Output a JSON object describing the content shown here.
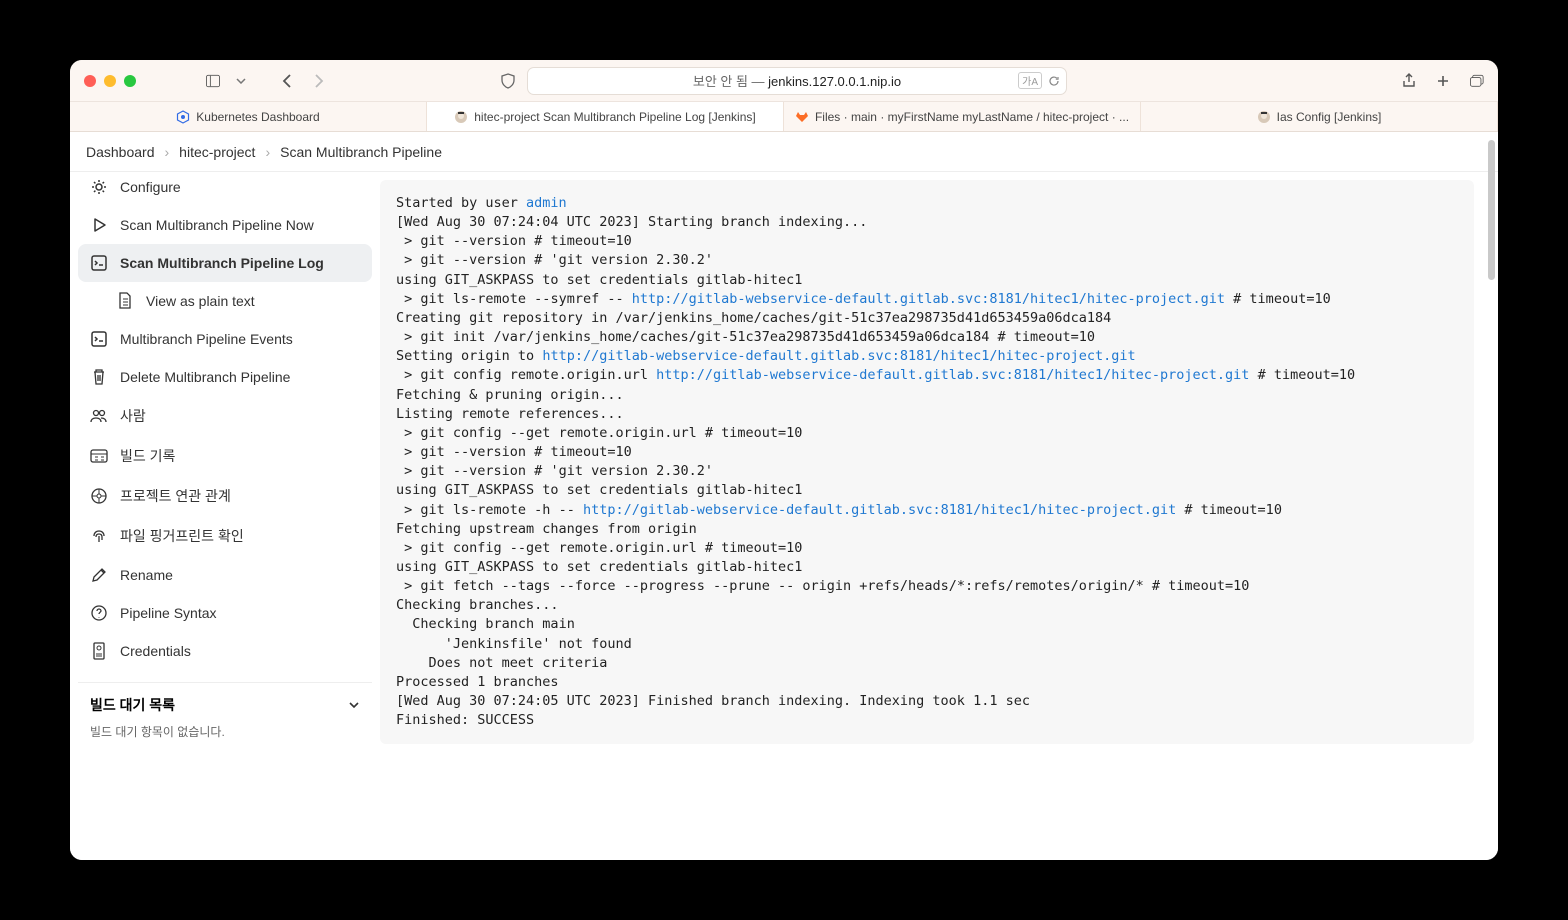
{
  "titlebar": {
    "security_prefix": "보안 안 됨 — ",
    "host": "jenkins.127.0.0.1.nip.io",
    "reader_badge": "가A"
  },
  "tabs": [
    {
      "label": "Kubernetes Dashboard",
      "icon": "k8s"
    },
    {
      "label": "hitec-project Scan Multibranch Pipeline Log [Jenkins]",
      "icon": "jenkins",
      "active": true
    },
    {
      "label": "Files · main · myFirstName myLastName / hitec-project · ...",
      "icon": "gitlab"
    },
    {
      "label": "Ias Config [Jenkins]",
      "icon": "jenkins"
    }
  ],
  "breadcrumb": [
    "Dashboard",
    "hitec-project",
    "Scan Multibranch Pipeline"
  ],
  "sidebar": {
    "items": [
      {
        "label": "Configure",
        "icon": "gear"
      },
      {
        "label": "Scan Multibranch Pipeline Now",
        "icon": "play"
      },
      {
        "label": "Scan Multibranch Pipeline Log",
        "icon": "log",
        "active": true
      },
      {
        "label": "View as plain text",
        "icon": "doc",
        "indent": true
      },
      {
        "label": "Multibranch Pipeline Events",
        "icon": "events"
      },
      {
        "label": "Delete Multibranch Pipeline",
        "icon": "trash"
      },
      {
        "label": "사람",
        "icon": "people"
      },
      {
        "label": "빌드 기록",
        "icon": "history"
      },
      {
        "label": "프로젝트 연관 관계",
        "icon": "relation"
      },
      {
        "label": "파일 핑거프린트 확인",
        "icon": "fingerprint"
      },
      {
        "label": "Rename",
        "icon": "pencil"
      },
      {
        "label": "Pipeline Syntax",
        "icon": "help"
      },
      {
        "label": "Credentials",
        "icon": "cred"
      }
    ],
    "queue_title": "빌드 대기 목록",
    "queue_empty": "빌드 대기 항목이 없습니다."
  },
  "log": {
    "l1a": "Started by user ",
    "l1_link": "admin",
    "l2": "[Wed Aug 30 07:24:04 UTC 2023] Starting branch indexing...",
    "l3": " > git --version # timeout=10",
    "l4": " > git --version # 'git version 2.30.2'",
    "l5": "using GIT_ASKPASS to set credentials gitlab-hitec1",
    "l6a": " > git ls-remote --symref -- ",
    "l6_link": "http://gitlab-webservice-default.gitlab.svc:8181/hitec1/hitec-project.git",
    "l6b": " # timeout=10",
    "l7": "Creating git repository in /var/jenkins_home/caches/git-51c37ea298735d41d653459a06dca184",
    "l8": " > git init /var/jenkins_home/caches/git-51c37ea298735d41d653459a06dca184 # timeout=10",
    "l9a": "Setting origin to ",
    "l9_link": "http://gitlab-webservice-default.gitlab.svc:8181/hitec1/hitec-project.git",
    "l10a": " > git config remote.origin.url ",
    "l10_link": "http://gitlab-webservice-default.gitlab.svc:8181/hitec1/hitec-project.git",
    "l10b": " # timeout=10",
    "l11": "Fetching & pruning origin...",
    "l12": "Listing remote references...",
    "l13": " > git config --get remote.origin.url # timeout=10",
    "l14": " > git --version # timeout=10",
    "l15": " > git --version # 'git version 2.30.2'",
    "l16": "using GIT_ASKPASS to set credentials gitlab-hitec1",
    "l17a": " > git ls-remote -h -- ",
    "l17_link": "http://gitlab-webservice-default.gitlab.svc:8181/hitec1/hitec-project.git",
    "l17b": " # timeout=10",
    "l18": "Fetching upstream changes from origin",
    "l19": " > git config --get remote.origin.url # timeout=10",
    "l20": "using GIT_ASKPASS to set credentials gitlab-hitec1",
    "l21": " > git fetch --tags --force --progress --prune -- origin +refs/heads/*:refs/remotes/origin/* # timeout=10",
    "l22": "Checking branches...",
    "l23": "  Checking branch main",
    "l24": "      'Jenkinsfile' not found",
    "l25": "    Does not meet criteria",
    "l26": "Processed 1 branches",
    "l27": "[Wed Aug 30 07:24:05 UTC 2023] Finished branch indexing. Indexing took 1.1 sec",
    "l28": "Finished: SUCCESS"
  }
}
